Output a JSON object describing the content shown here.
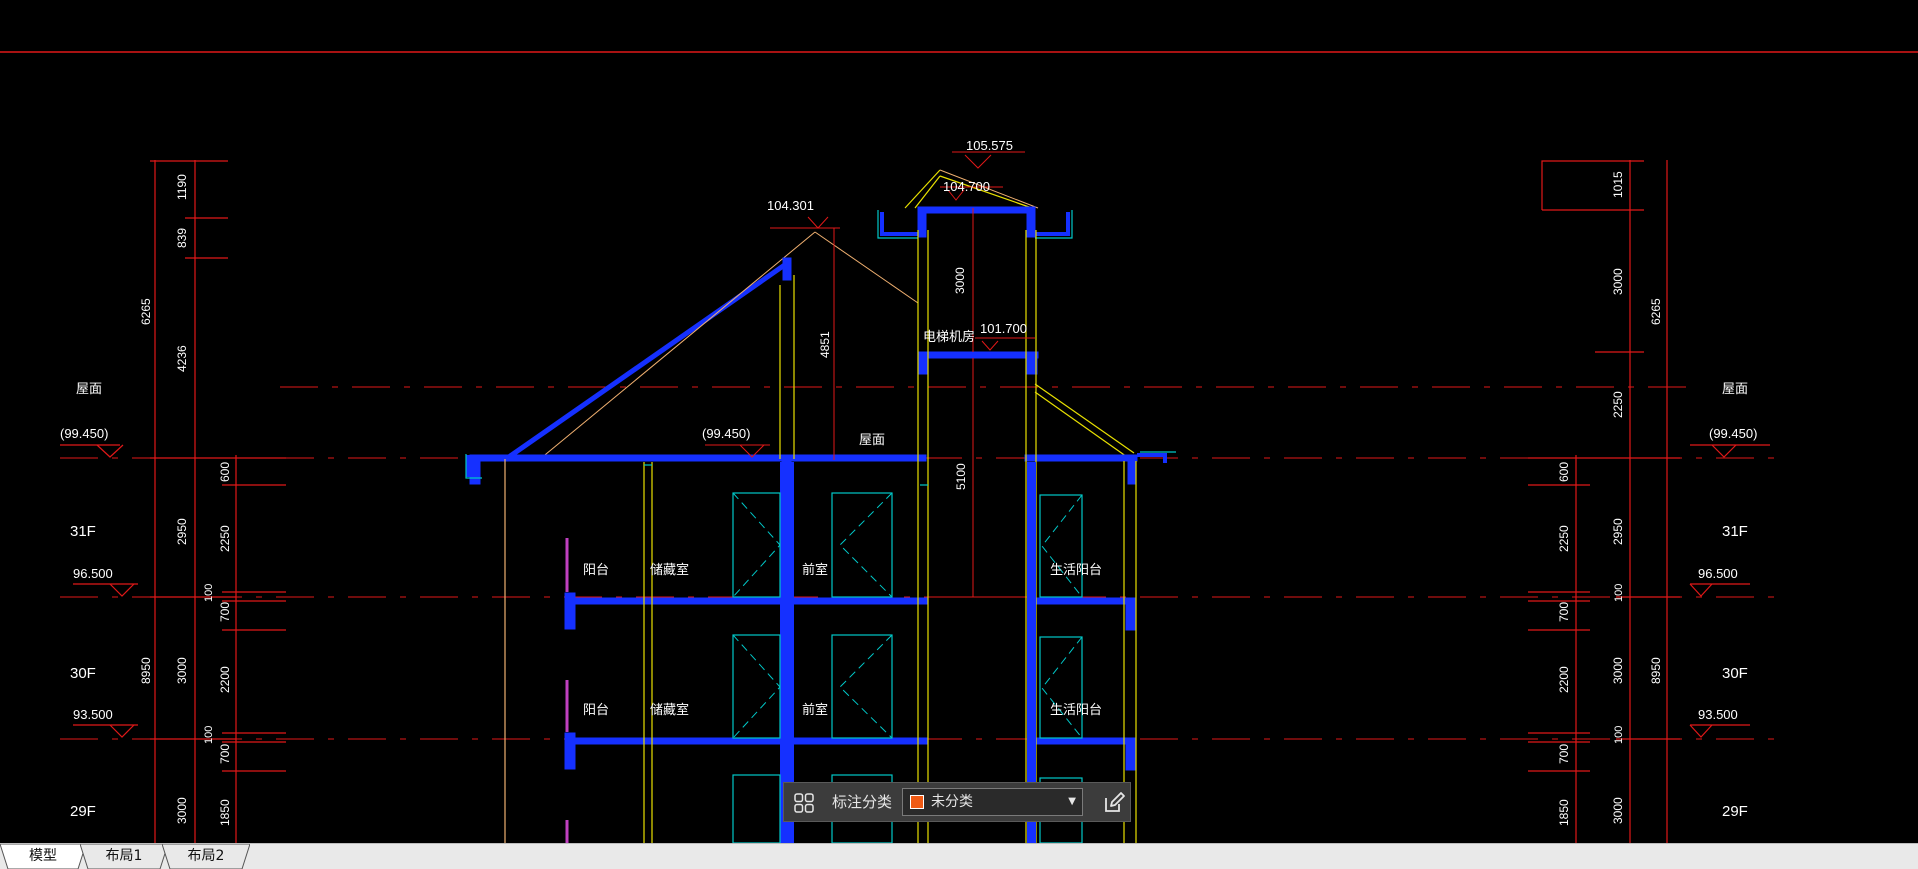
{
  "colors": {
    "background": "#000000",
    "axis_line": "#e01818",
    "wall_blue": "#1530ff",
    "window_cyan": "#00c8c8",
    "yellow_line": "#e8e000",
    "roof_orange": "#f0b070",
    "accent_swatch": "#f05a14"
  },
  "drawing": {
    "elevations": [
      "105.575",
      "104.700",
      "104.301",
      "101.700",
      "(99.450)",
      "(99.450)",
      "(99.450)",
      "96.500",
      "96.500",
      "93.500",
      "93.500"
    ],
    "floor_labels": [
      "31F",
      "30F",
      "29F",
      "31F",
      "30F",
      "29F"
    ],
    "roof_labels": [
      "屋面",
      "屋面",
      "屋面"
    ],
    "left_dims": [
      "1190",
      "839",
      "4236",
      "6265",
      "600",
      "2950",
      "2250",
      "100",
      "700",
      "3000",
      "8950",
      "2200",
      "100",
      "700",
      "3000",
      "1850"
    ],
    "right_dims": [
      "1015",
      "3000",
      "6265",
      "2250",
      "600",
      "2950",
      "2250",
      "100",
      "700",
      "3000",
      "8950",
      "2200",
      "100",
      "700",
      "3000",
      "1850"
    ],
    "center_dims": [
      "3000",
      "4851",
      "5100"
    ],
    "room_labels": [
      "阳台",
      "储藏室",
      "前室",
      "生活阳台",
      "阳台",
      "储藏室",
      "前室",
      "生活阳台",
      "电梯机房"
    ]
  },
  "annotation_toolbar": {
    "grid_icon": "grid-icon",
    "label": "标注分类",
    "selected_value": "未分类",
    "edit_icon": "edit-icon"
  },
  "layout_tabs": [
    {
      "label": "模型",
      "active": true
    },
    {
      "label": "布局1",
      "active": false
    },
    {
      "label": "布局2",
      "active": false
    }
  ]
}
